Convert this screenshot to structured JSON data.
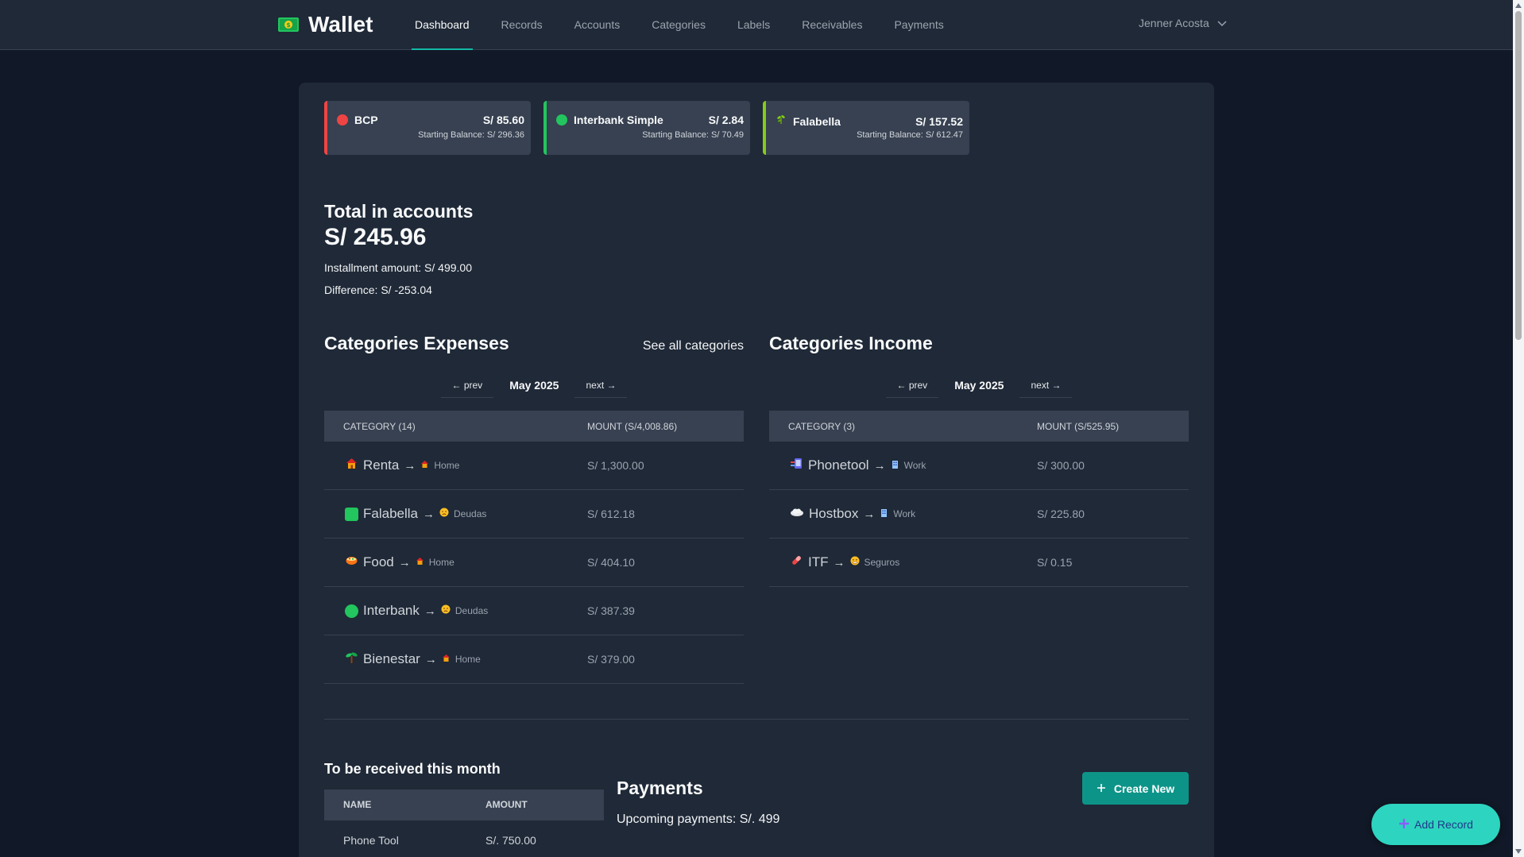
{
  "app": {
    "name": "Wallet"
  },
  "nav": {
    "items": [
      {
        "label": "Dashboard",
        "active": true
      },
      {
        "label": "Records"
      },
      {
        "label": "Accounts"
      },
      {
        "label": "Categories"
      },
      {
        "label": "Labels"
      },
      {
        "label": "Receivables"
      },
      {
        "label": "Payments"
      }
    ]
  },
  "user": {
    "name": "Jenner Acosta"
  },
  "accounts": [
    {
      "name": "BCP",
      "balance": "S/ 85.60",
      "starting": "Starting Balance: S/ 296.36",
      "color": "#ef4444",
      "icon": "red-circle-icon"
    },
    {
      "name": "Interbank Simple",
      "balance": "S/ 2.84",
      "starting": "Starting Balance: S/ 70.49",
      "color": "#22c55e",
      "icon": "green-circle-icon"
    },
    {
      "name": "Falabella",
      "balance": "S/ 157.52",
      "starting": "Starting Balance: S/ 612.47",
      "color": "#84cc16",
      "icon": "herb-icon"
    }
  ],
  "totals": {
    "title": "Total in accounts",
    "amount": "S/ 245.96",
    "installment": "Installment amount: S/ 499.00",
    "difference": "Difference: S/ -253.04"
  },
  "expenses": {
    "title": "Categories Expenses",
    "see_all": "See all categories",
    "prev": "← prev",
    "month": "May 2025",
    "next": "next →",
    "col_category": "CATEGORY (14)",
    "col_amount": "MOUNT (S/4,008.86)",
    "rows": [
      {
        "name": "Renta",
        "sub": "Home",
        "amount": "S/ 1,300.00",
        "icon": "house-icon",
        "sub_icon": "house-garden-icon"
      },
      {
        "name": "Falabella",
        "sub": "Deudas",
        "amount": "S/ 612.18",
        "icon": "green-square-icon",
        "sub_icon": "worried-face-icon"
      },
      {
        "name": "Food",
        "sub": "Home",
        "amount": "S/ 404.10",
        "icon": "pot-of-food-icon",
        "sub_icon": "house-garden-icon"
      },
      {
        "name": "Interbank",
        "sub": "Deudas",
        "amount": "S/ 387.39",
        "icon": "green-circle-icon",
        "sub_icon": "worried-face-icon"
      },
      {
        "name": "Bienestar",
        "sub": "Home",
        "amount": "S/ 379.00",
        "icon": "seedling-icon",
        "sub_icon": "house-garden-icon"
      }
    ]
  },
  "income": {
    "title": "Categories Income",
    "prev": "← prev",
    "month": "May 2025",
    "next": "next →",
    "col_category": "CATEGORY (3)",
    "col_amount": "MOUNT (S/525.95)",
    "rows": [
      {
        "name": "Phonetool",
        "sub": "Work",
        "amount": "S/ 300.00",
        "icon": "phone-tool-icon",
        "sub_icon": "office-building-icon"
      },
      {
        "name": "Hostbox",
        "sub": "Work",
        "amount": "S/ 225.80",
        "icon": "cloud-icon",
        "sub_icon": "office-building-icon"
      },
      {
        "name": "ITF",
        "sub": "Seguros",
        "amount": "S/ 0.15",
        "icon": "pill-icon",
        "sub_icon": "grimace-face-icon"
      }
    ]
  },
  "receivables": {
    "title": "To be received this month",
    "col_name": "NAME",
    "col_amount": "AMOUNT",
    "rows": [
      {
        "name": "Phone Tool",
        "amount": "S/. 750.00"
      }
    ]
  },
  "payments": {
    "title": "Payments",
    "upcoming": "Upcoming payments: S/. 499",
    "create_label": "Create New"
  },
  "fab": {
    "label": "Add Record"
  },
  "colors": {
    "accent": "#14b8a6",
    "button": "#0d9488",
    "fab": "#2dd4bf",
    "background": "#111827",
    "panel": "#1f2937"
  }
}
